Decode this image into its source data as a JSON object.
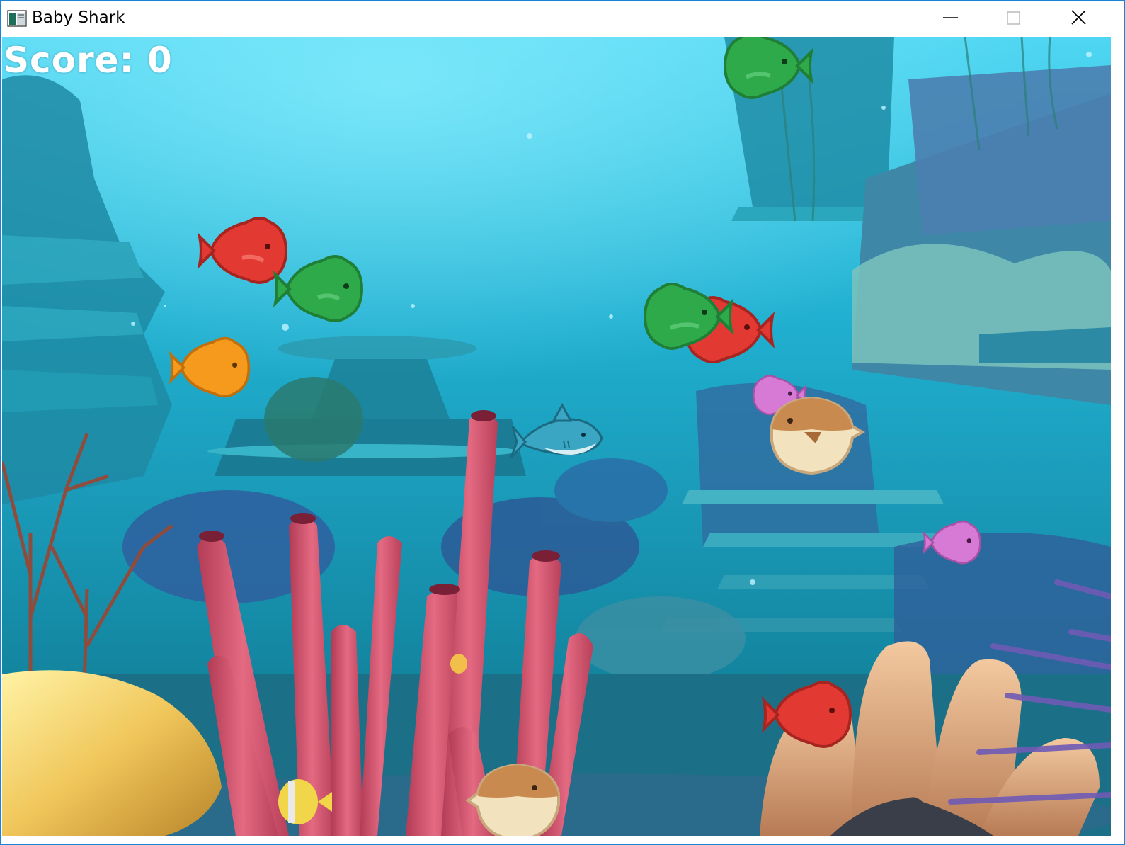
{
  "window": {
    "title": "Baby Shark",
    "controls": [
      "minimize-icon",
      "maximize-icon",
      "close-icon"
    ]
  },
  "hud": {
    "score_text": "Score: 0"
  },
  "scene": {
    "background": "underwater-coral-reef",
    "player": "baby-shark",
    "fish": [
      {
        "kind": "fish",
        "color": "green"
      },
      {
        "kind": "fish",
        "color": "red"
      },
      {
        "kind": "fish",
        "color": "green"
      },
      {
        "kind": "fish",
        "color": "orange"
      },
      {
        "kind": "fish",
        "color": "green"
      },
      {
        "kind": "fish",
        "color": "red"
      },
      {
        "kind": "fish",
        "color": "pink"
      },
      {
        "kind": "fish",
        "color": "pink"
      },
      {
        "kind": "fish",
        "color": "red"
      },
      {
        "kind": "pufferfish",
        "color": "brown"
      },
      {
        "kind": "pufferfish",
        "color": "brown"
      }
    ]
  },
  "colors": {
    "water_top": "#4fd3f0",
    "water_mid": "#1fa7c8",
    "fish_red": "#e23a33",
    "fish_green": "#2eaa4a",
    "fish_orange": "#f59a1c",
    "fish_pink": "#d77ad6",
    "shark": "#3aa6c4",
    "puffer_body": "#f2e2bd",
    "puffer_top": "#c98a4f",
    "coral_pink": "#d8536b",
    "titlebar_border": "#1883d7"
  }
}
